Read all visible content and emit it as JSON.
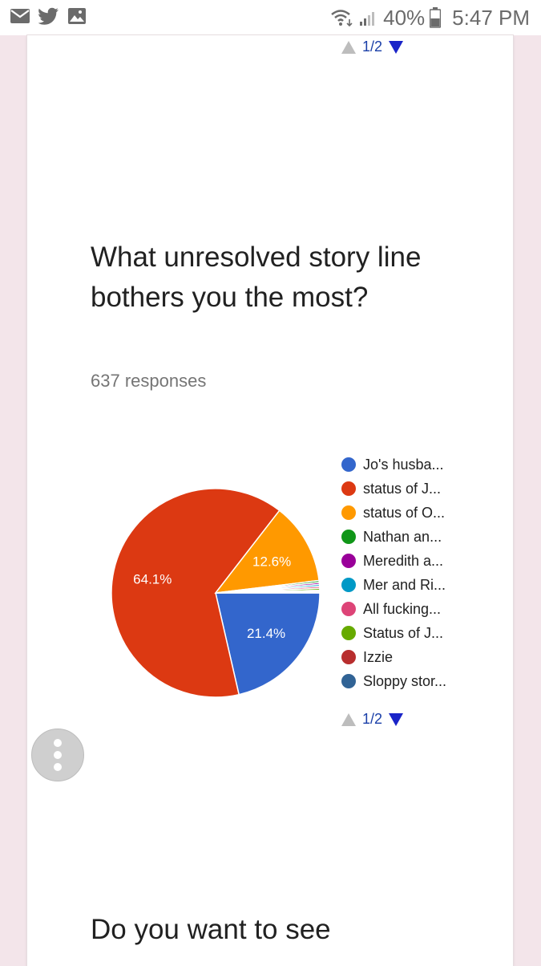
{
  "status_bar": {
    "battery": "40%",
    "time": "5:47 PM"
  },
  "pager": {
    "top_label": "1/2",
    "bottom_label": "1/2"
  },
  "question": {
    "title": "What unresolved story line bothers you the most?",
    "responses": "637 responses"
  },
  "next_question": {
    "title": "Do you want to see"
  },
  "colors": {
    "blue": "#3366cc",
    "red": "#dc3912",
    "orange": "#ff9900"
  },
  "chart_data": {
    "type": "pie",
    "slices": [
      {
        "label": "Jo's husba...",
        "value": 21.4,
        "value_label": "21.4%",
        "color": "#3366cc"
      },
      {
        "label": "status of J...",
        "value": 64.1,
        "value_label": "64.1%",
        "color": "#dc3912"
      },
      {
        "label": "status of O...",
        "value": 12.6,
        "value_label": "12.6%",
        "color": "#ff9900"
      },
      {
        "label": "Nathan an...",
        "value": 0.3,
        "value_label": "",
        "color": "#109618"
      },
      {
        "label": "Meredith a...",
        "value": 0.3,
        "value_label": "",
        "color": "#990099"
      },
      {
        "label": "Mer and Ri...",
        "value": 0.3,
        "value_label": "",
        "color": "#0099c6"
      },
      {
        "label": "All fucking...",
        "value": 0.3,
        "value_label": "",
        "color": "#dd4477"
      },
      {
        "label": "Status of J...",
        "value": 0.3,
        "value_label": "",
        "color": "#66aa00"
      },
      {
        "label": "Izzie",
        "value": 0.2,
        "value_label": "",
        "color": "#b82e2e"
      },
      {
        "label": "Sloppy stor...",
        "value": 0.2,
        "value_label": "",
        "color": "#316395"
      }
    ],
    "legend_position": "right"
  }
}
